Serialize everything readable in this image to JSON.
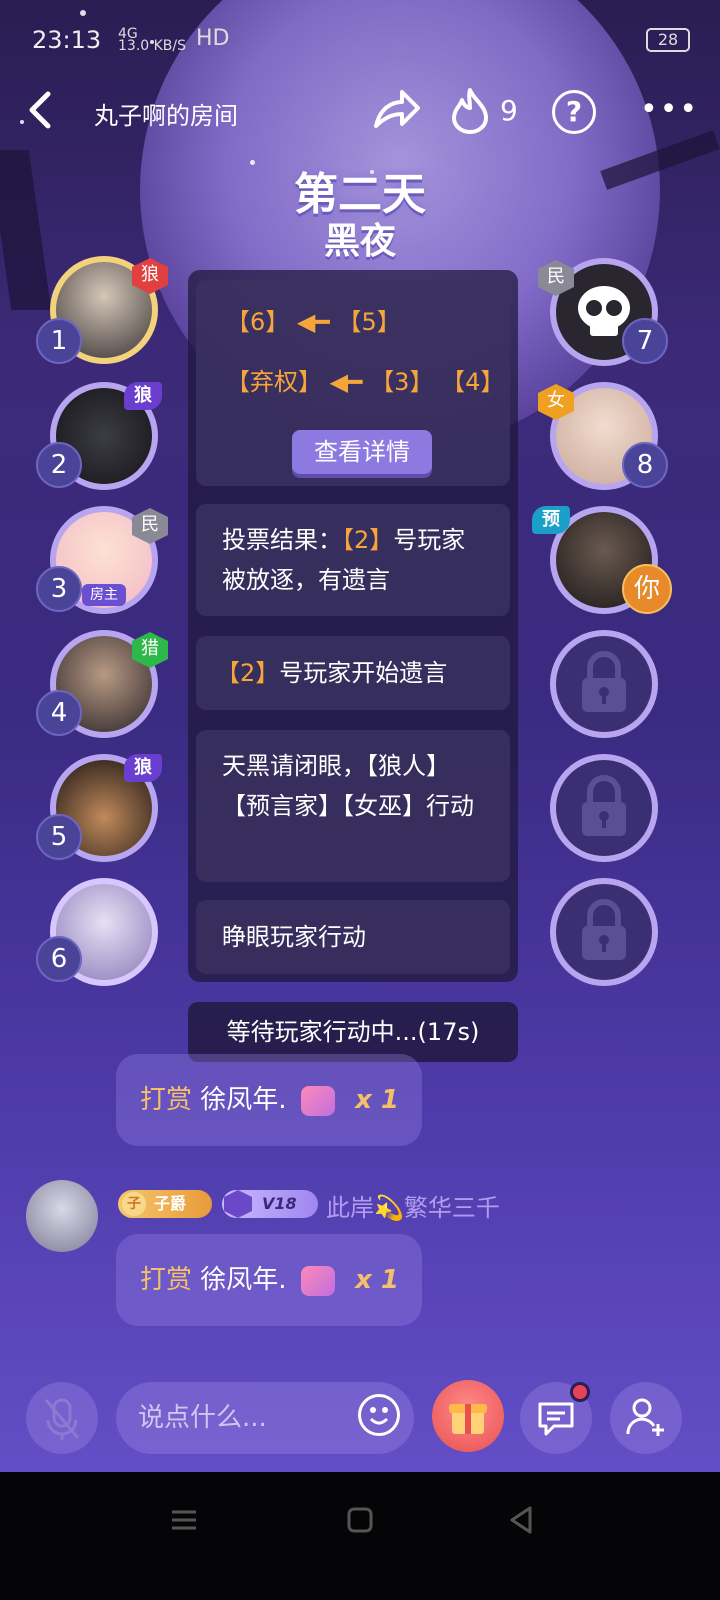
{
  "status_bar": {
    "time": "23:13",
    "network": "4G",
    "speed": "13.0 KB/S",
    "hd": "HD",
    "battery": "28"
  },
  "header": {
    "title": "丸子啊的房间",
    "hot_count": "9"
  },
  "phase": {
    "day": "第二天",
    "period": "黑夜"
  },
  "seats_left": [
    {
      "number": "1",
      "role": "狼"
    },
    {
      "number": "2",
      "role": "狼"
    },
    {
      "number": "3",
      "role": "民",
      "host_label": "房主"
    },
    {
      "number": "4",
      "role": "猎"
    },
    {
      "number": "5",
      "role": "狼"
    },
    {
      "number": "6",
      "role": ""
    }
  ],
  "seats_right": [
    {
      "number": "7",
      "role": "民"
    },
    {
      "number": "8",
      "role": "女"
    },
    {
      "number": "",
      "role": "预",
      "you_label": "你"
    }
  ],
  "log": {
    "vote_line1_a": "【6】",
    "vote_line1_b": "【5】",
    "vote_line2_a": "【弃权】",
    "vote_line2_b": "【3】",
    "vote_line2_c": "【4】",
    "detail_button": "查看详情",
    "result_prefix": "投票结果：",
    "result_player": "【2】",
    "result_suffix": "号玩家被放逐，有遗言",
    "lastword_player": "【2】",
    "lastword_text": "号玩家开始遗言",
    "night_text": "天黑请闭眼，【狼人】【预言家】【女巫】行动",
    "open_eyes": "睁眼玩家行动"
  },
  "waiting": "等待玩家行动中...(17s)",
  "chat": [
    {
      "action": "打赏",
      "name": "徐凤年.",
      "count": "x 1"
    },
    {
      "user": "此岸💫繁华三千",
      "badge_noble": "子爵",
      "badge_noble_short": "子",
      "badge_vip": "V18",
      "action": "打赏",
      "name": "徐凤年.",
      "count": "x 1"
    }
  ],
  "input": {
    "placeholder": "说点什么..."
  }
}
